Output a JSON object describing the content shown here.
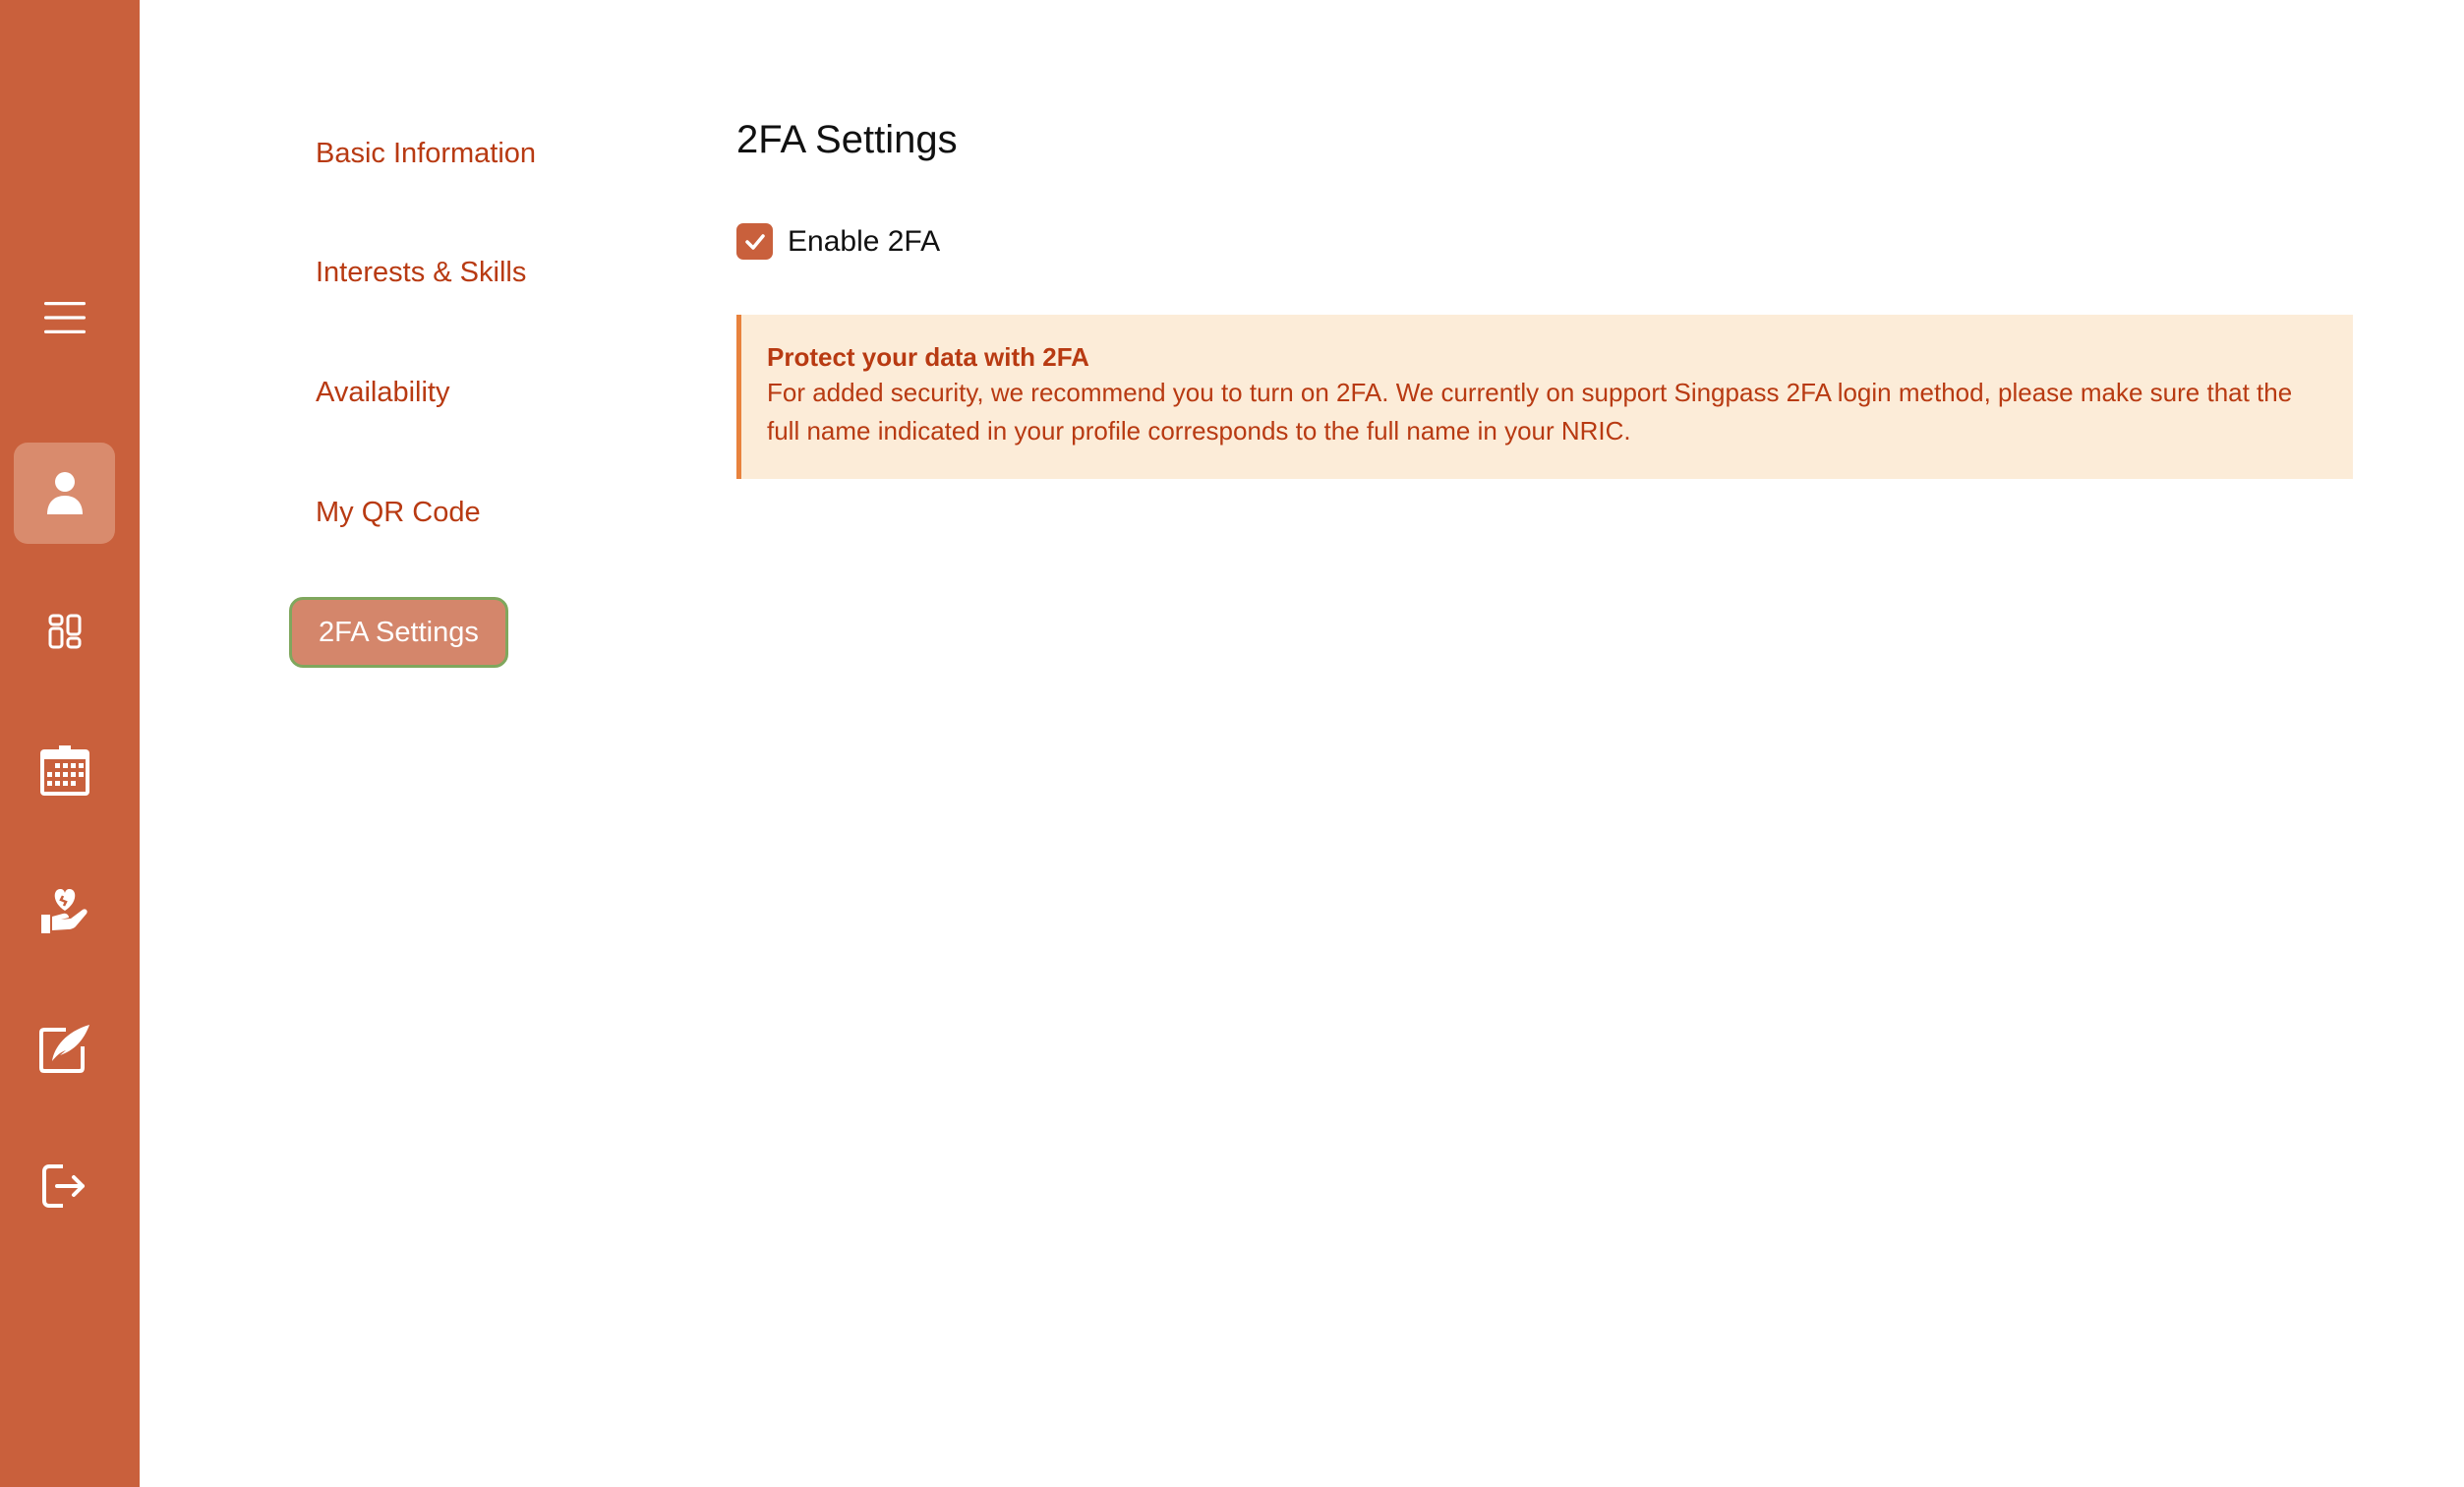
{
  "sidebar": {
    "icons": [
      {
        "name": "menu-icon",
        "active": false
      },
      {
        "name": "profile-icon",
        "active": true
      },
      {
        "name": "dashboard-icon",
        "active": false
      },
      {
        "name": "calendar-icon",
        "active": false
      },
      {
        "name": "volunteer-heart-hand-icon",
        "active": false
      },
      {
        "name": "edit-quill-icon",
        "active": false
      },
      {
        "name": "logout-icon",
        "active": false
      }
    ]
  },
  "subnav": {
    "items": [
      {
        "label": "Basic Information",
        "active": false
      },
      {
        "label": "Interests & Skills",
        "active": false
      },
      {
        "label": "Availability",
        "active": false
      },
      {
        "label": "My QR Code",
        "active": false
      },
      {
        "label": "2FA Settings",
        "active": true
      }
    ]
  },
  "main": {
    "title": "2FA Settings",
    "enable_2fa": {
      "label": "Enable 2FA",
      "checked": true
    },
    "alert": {
      "title": "Protect your data with 2FA",
      "body": "For added security, we recommend you to turn on 2FA. We currently on support Singpass 2FA login method, please make sure that the full name indicated in your profile corresponds to the full name in your NRIC."
    }
  },
  "colors": {
    "sidebar": "#c9603c",
    "sidebar_active": "#d98b6d",
    "accent_text": "#b83a12",
    "alert_bg": "#fcecd8",
    "alert_border": "#e8823d"
  }
}
